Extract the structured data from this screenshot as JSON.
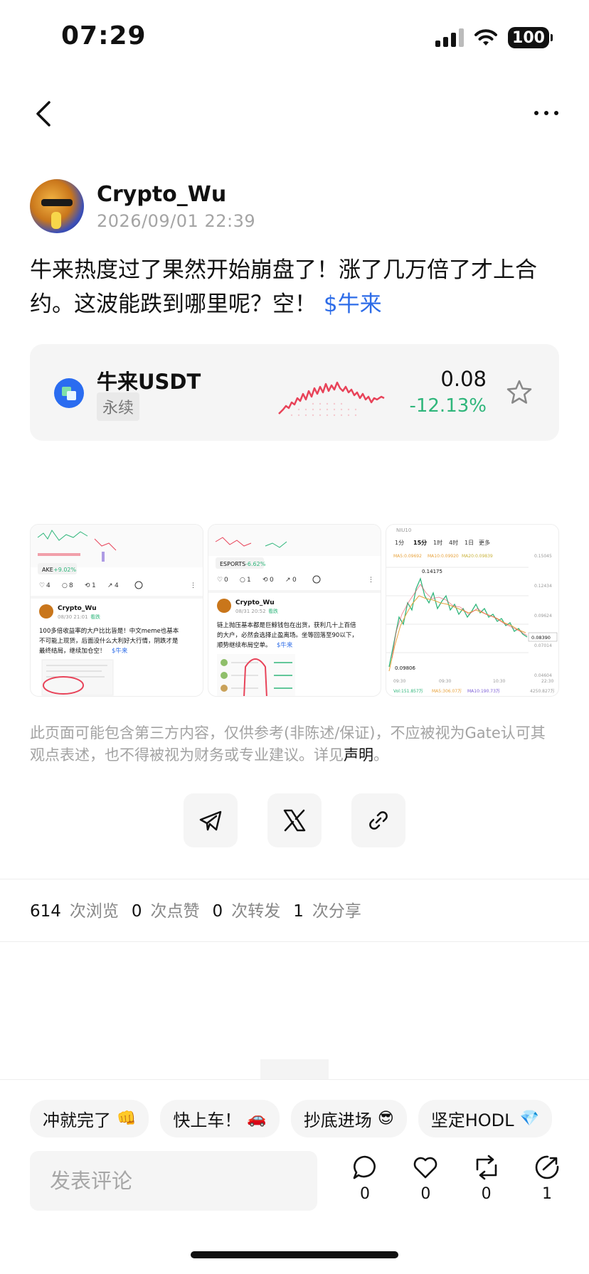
{
  "status_bar": {
    "time": "07:29",
    "battery": "100"
  },
  "post": {
    "author": "Crypto_Wu",
    "timestamp": "2026/09/01 22:39",
    "text": "牛来热度过了果然开始崩盘了！涨了几万倍了才上合约。这波能跌到哪里呢？空！",
    "link": "$牛来"
  },
  "ticker": {
    "name": "牛来USDT",
    "tag": "永续",
    "price": "0.08",
    "change": "-12.13%",
    "change_color": "#2fb67b",
    "sparkline_color": "#e84359"
  },
  "thumbnails": {
    "t1": {
      "tag": "AKE",
      "tag_change": "+9.02%",
      "stats": [
        "4",
        "8",
        "1",
        "4"
      ],
      "user": "Crypto_Wu",
      "time": "08/30 21:01",
      "badge": "看跌",
      "text_l1": "100多倍收益率的大户比比皆是！中文meme也基本",
      "text_l2": "不可能上现货，后面没什么大利好大行情，阴跌才是",
      "text_l3": "最终结局，继续加仓空！",
      "link": "$牛来"
    },
    "t2": {
      "tag": "ESPORTS",
      "tag_change": "-6.62%",
      "stats": [
        "0",
        "1",
        "0",
        "0"
      ],
      "user": "Crypto_Wu",
      "time": "08/31 20:52",
      "badge": "看跌",
      "text_l1": "链上抛压基本都是巨鲸钱包在出货，获利几十上百倍",
      "text_l2": "的大户，必然会选择止盈离场。坐等回落至90以下，",
      "text_l3": "顺势继续布局空单。",
      "link": "$牛来"
    },
    "t3": {
      "header": "NIU10",
      "tabs": [
        "1分",
        "15分",
        "1时",
        "4时",
        "1日",
        "更多"
      ],
      "ma": [
        "MA5:0.09692",
        "MA10:0.09920",
        "MA20:0.09839"
      ],
      "high": "0.14175",
      "low": "0.09806",
      "current": "0.08390",
      "axis": [
        "0.15045",
        "0.12434",
        "0.09624",
        "0.07014",
        "0.04604"
      ],
      "times": [
        "09:30",
        "09:30",
        "10:30",
        "22:30"
      ],
      "vol": "Vol:151.857万",
      "vol_ma5": "MA5:306.07万",
      "vol_ma10": "MA10:190.73万",
      "vol_right": "4250.827万"
    }
  },
  "disclaimer": {
    "text": "此页面可能包含第三方内容，仅供参考(非陈述/保证)，不应被视为Gate认可其观点表述，也不得被视为财务或专业建议。详见",
    "link": "声明",
    "end": "。"
  },
  "stats": {
    "views": "614",
    "views_label": "次浏览",
    "likes": "0",
    "likes_label": "次点赞",
    "reposts": "0",
    "reposts_label": "次转发",
    "shares": "1",
    "shares_label": "次分享"
  },
  "quick_replies": [
    {
      "label": "冲就完了",
      "emoji": "👊"
    },
    {
      "label": "快上车！",
      "emoji": "🚗"
    },
    {
      "label": "抄底进场",
      "emoji": "😎"
    },
    {
      "label": "坚定HODL",
      "emoji": "💎"
    }
  ],
  "comment": {
    "placeholder": "发表评论"
  },
  "actions": {
    "comments": "0",
    "likes": "0",
    "reposts": "0",
    "shares": "1"
  }
}
